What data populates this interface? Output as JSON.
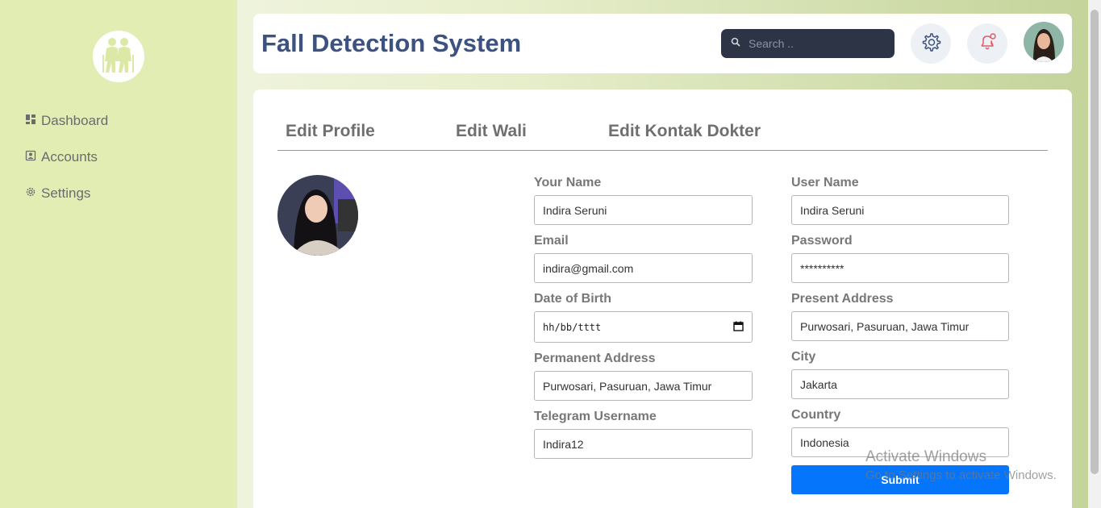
{
  "sidebar": {
    "items": [
      {
        "label": "Dashboard",
        "icon": "dashboard-icon"
      },
      {
        "label": "Accounts",
        "icon": "account-icon"
      },
      {
        "label": "Settings",
        "icon": "gear-icon"
      }
    ]
  },
  "header": {
    "title": "Fall Detection System",
    "search_placeholder": "Search ..",
    "icons": [
      "settings-icon",
      "bell-icon"
    ]
  },
  "tabs": [
    "Edit Profile",
    "Edit Wali",
    "Edit Kontak Dokter"
  ],
  "form": {
    "your_name": {
      "label": "Your Name",
      "value": "Indira Seruni"
    },
    "user_name": {
      "label": "User Name",
      "value": "Indira Seruni"
    },
    "email": {
      "label": "Email",
      "value": "indira@gmail.com"
    },
    "password": {
      "label": "Password",
      "value": "**********"
    },
    "dob": {
      "label": "Date of Birth",
      "value": "hh/bb/tttt"
    },
    "present_address": {
      "label": "Present Address",
      "value": "Purwosari, Pasuruan, Jawa Timur"
    },
    "permanent_address": {
      "label": "Permanent Address",
      "value": "Purwosari, Pasuruan, Jawa Timur"
    },
    "city": {
      "label": "City",
      "value": "Jakarta"
    },
    "telegram": {
      "label": "Telegram Username",
      "value": "Indira12"
    },
    "country": {
      "label": "Country",
      "value": "Indonesia"
    },
    "submit_label": "Submit"
  },
  "watermark": {
    "line1": "Activate Windows",
    "line2": "Go to Settings to activate Windows."
  },
  "colors": {
    "sidebar": "#e2edb4",
    "title": "#3d5280",
    "search_bg": "#2c3446",
    "submit": "#0575fb"
  }
}
